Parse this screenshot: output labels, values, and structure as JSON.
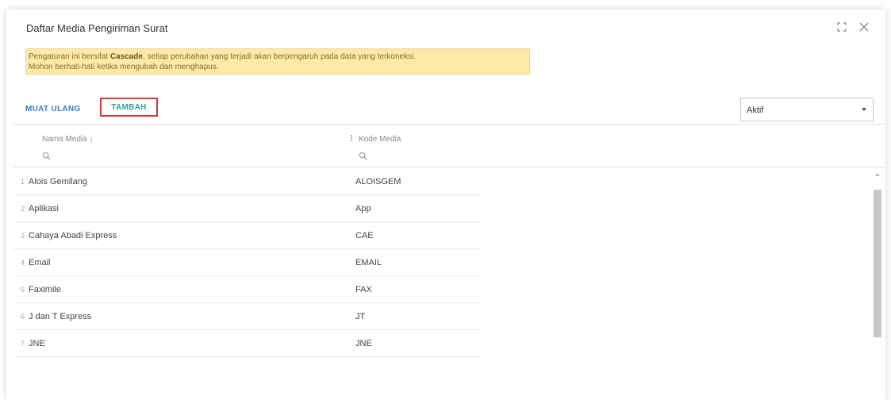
{
  "dialog": {
    "title": "Daftar Media Pengiriman Surat"
  },
  "warning": {
    "text_before_bold": "Pengaturan ini bersifat ",
    "bold": "Cascade",
    "text_after_bold": ", setiap perubahan yang terjadi akan berpengaruh pada data yang terkoneksi.",
    "line2": "Mohon berhati-hati ketika mengubah dan menghapus."
  },
  "toolbar": {
    "reload_label": "MUAT ULANG",
    "add_label": "TAMBAH"
  },
  "status_select": {
    "value": "Aktif"
  },
  "columns": {
    "name_header": "Nama Media",
    "code_header": "Kode Media",
    "sort_indicator": "↓"
  },
  "rows": [
    {
      "num": "1",
      "name": "Alois Gemilang",
      "code": "ALOISGEM"
    },
    {
      "num": "2",
      "name": "Aplikasi",
      "code": "App"
    },
    {
      "num": "3",
      "name": "Cahaya Abadi Express",
      "code": "CAE"
    },
    {
      "num": "4",
      "name": "Email",
      "code": "EMAIL"
    },
    {
      "num": "5",
      "name": "Faximile",
      "code": "FAX"
    },
    {
      "num": "6",
      "name": "J dan T Express",
      "code": "JT"
    },
    {
      "num": "7",
      "name": "JNE",
      "code": "JNE"
    }
  ],
  "colors": {
    "accent_blue": "#3a7bc8",
    "accent_teal": "#2aa3a3",
    "highlight_red": "#d23a3a",
    "warning_bg": "#fde9a8"
  }
}
